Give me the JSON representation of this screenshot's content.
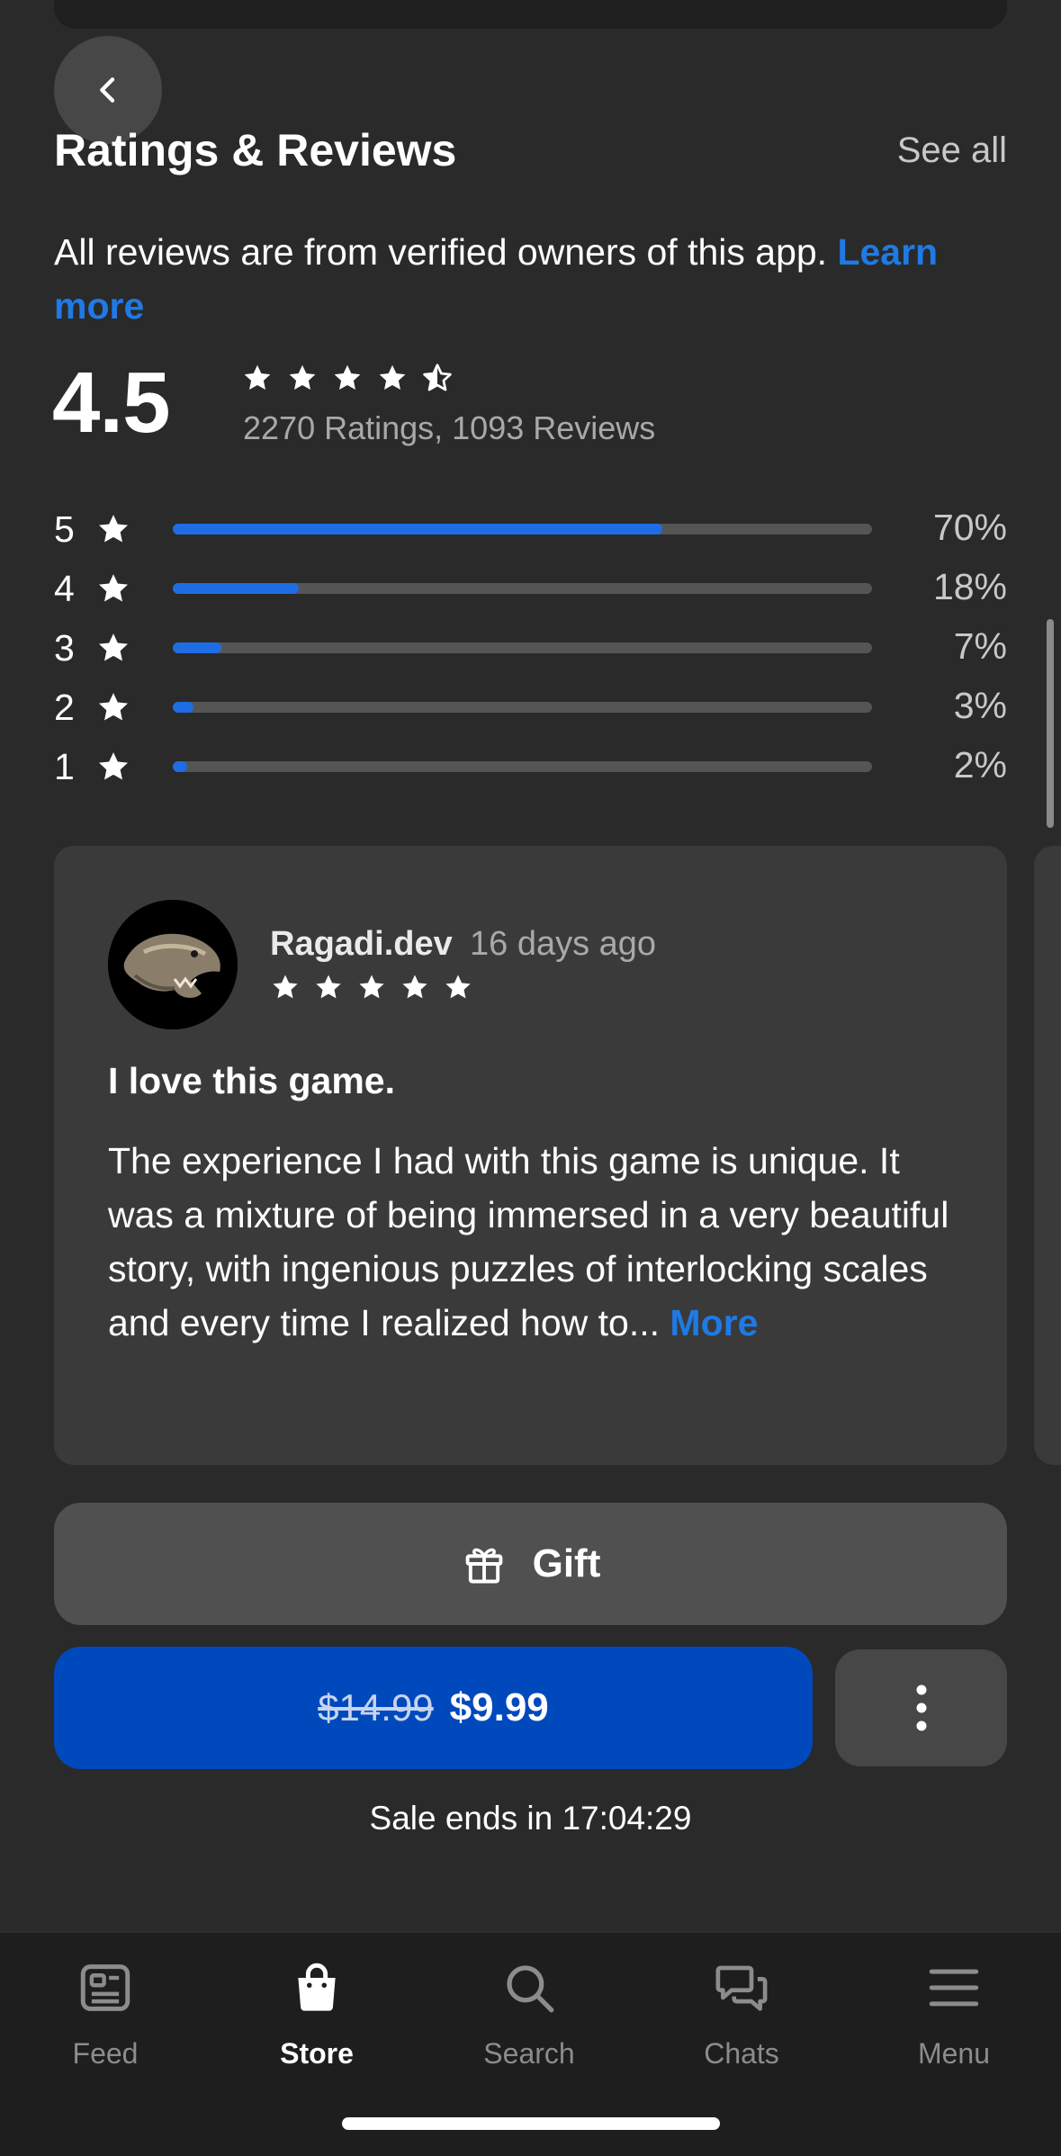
{
  "section": {
    "title": "Ratings & Reviews",
    "see_all": "See all"
  },
  "verified": {
    "text": "All reviews are from verified owners of this app. ",
    "link": "Learn more"
  },
  "summary": {
    "score": "4.5",
    "stars": 4.5,
    "counts": "2270 Ratings, 1093 Reviews"
  },
  "distribution": [
    {
      "stars": "5",
      "percent": 70,
      "label": "70%"
    },
    {
      "stars": "4",
      "percent": 18,
      "label": "18%"
    },
    {
      "stars": "3",
      "percent": 7,
      "label": "7%"
    },
    {
      "stars": "2",
      "percent": 3,
      "label": "3%"
    },
    {
      "stars": "1",
      "percent": 2,
      "label": "2%"
    }
  ],
  "review": {
    "author": "Ragadi.dev",
    "date": "16 days ago",
    "rating": 5,
    "title": "I love this game.",
    "body": "The experience I had with this game is unique. It was a mixture of being immersed in a very beautiful story, with ingenious puzzles of interlocking scales and every time I realized how to... ",
    "more": "More"
  },
  "actions": {
    "gift_label": "Gift",
    "price_old": "$14.99",
    "price_new": "$9.99",
    "sale_ends": "Sale ends in 17:04:29"
  },
  "tabs": [
    {
      "label": "Feed",
      "icon": "feed-icon"
    },
    {
      "label": "Store",
      "icon": "store-icon",
      "active": true
    },
    {
      "label": "Search",
      "icon": "search-icon"
    },
    {
      "label": "Chats",
      "icon": "chats-icon"
    },
    {
      "label": "Menu",
      "icon": "menu-icon"
    }
  ],
  "colors": {
    "accent": "#1f7ae6",
    "bar_fill": "#1f6de5",
    "buy_button": "#0049bd",
    "background": "#2a2a2a"
  }
}
